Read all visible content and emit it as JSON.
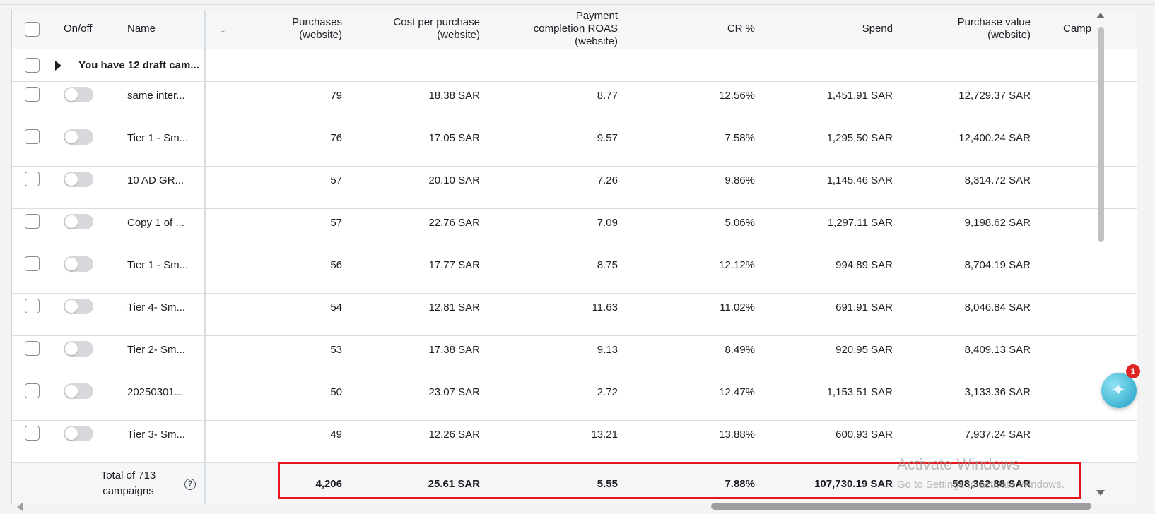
{
  "columns": {
    "on_off": "On/off",
    "name": "Name",
    "purchases": [
      "Purchases",
      "(website)"
    ],
    "cost_per_purchase": [
      "Cost per purchase",
      "(website)"
    ],
    "roas": [
      "Payment",
      "completion ROAS",
      "(website)"
    ],
    "cr": "CR %",
    "spend": "Spend",
    "purchase_value": [
      "Purchase value",
      "(website)"
    ],
    "campaign_truncated": "Camp"
  },
  "draft_row": {
    "label": "You have 12 draft cam..."
  },
  "rows": [
    {
      "name": "same inter...",
      "purchases": "79",
      "cost": "18.38 SAR",
      "roas": "8.77",
      "cr": "12.56%",
      "spend": "1,451.91 SAR",
      "value": "12,729.37 SAR"
    },
    {
      "name": "Tier 1 - Sm...",
      "purchases": "76",
      "cost": "17.05 SAR",
      "roas": "9.57",
      "cr": "7.58%",
      "spend": "1,295.50 SAR",
      "value": "12,400.24 SAR"
    },
    {
      "name": "10 AD GR...",
      "purchases": "57",
      "cost": "20.10 SAR",
      "roas": "7.26",
      "cr": "9.86%",
      "spend": "1,145.46 SAR",
      "value": "8,314.72 SAR"
    },
    {
      "name": "Copy 1 of ...",
      "purchases": "57",
      "cost": "22.76 SAR",
      "roas": "7.09",
      "cr": "5.06%",
      "spend": "1,297.11 SAR",
      "value": "9,198.62 SAR"
    },
    {
      "name": "Tier 1 - Sm...",
      "purchases": "56",
      "cost": "17.77 SAR",
      "roas": "8.75",
      "cr": "12.12%",
      "spend": "994.89 SAR",
      "value": "8,704.19 SAR"
    },
    {
      "name": "Tier 4- Sm...",
      "purchases": "54",
      "cost": "12.81 SAR",
      "roas": "11.63",
      "cr": "11.02%",
      "spend": "691.91 SAR",
      "value": "8,046.84 SAR"
    },
    {
      "name": "Tier 2- Sm...",
      "purchases": "53",
      "cost": "17.38 SAR",
      "roas": "9.13",
      "cr": "8.49%",
      "spend": "920.95 SAR",
      "value": "8,409.13 SAR"
    },
    {
      "name": "20250301...",
      "purchases": "50",
      "cost": "23.07 SAR",
      "roas": "2.72",
      "cr": "12.47%",
      "spend": "1,153.51 SAR",
      "value": "3,133.36 SAR"
    },
    {
      "name": "Tier 3- Sm...",
      "purchases": "49",
      "cost": "12.26 SAR",
      "roas": "13.21",
      "cr": "13.88%",
      "spend": "600.93 SAR",
      "value": "7,937.24 SAR"
    }
  ],
  "totals": {
    "label_line1": "Total of 713",
    "label_line2": "campaigns",
    "help_glyph": "?",
    "purchases": "4,206",
    "cost": "25.61 SAR",
    "roas": "5.55",
    "cr": "7.88%",
    "spend": "107,730.19 SAR",
    "value": "598,362.88 SAR"
  },
  "watermark": {
    "title": "Activate Windows",
    "subtitle": "Go to Settings to activate Windows."
  },
  "assistant": {
    "badge_count": "1",
    "icon": "sparkle-icon"
  },
  "colors": {
    "highlight": "#e8161b",
    "header_bg": "#f5f6f7",
    "badge": "#e02424"
  }
}
